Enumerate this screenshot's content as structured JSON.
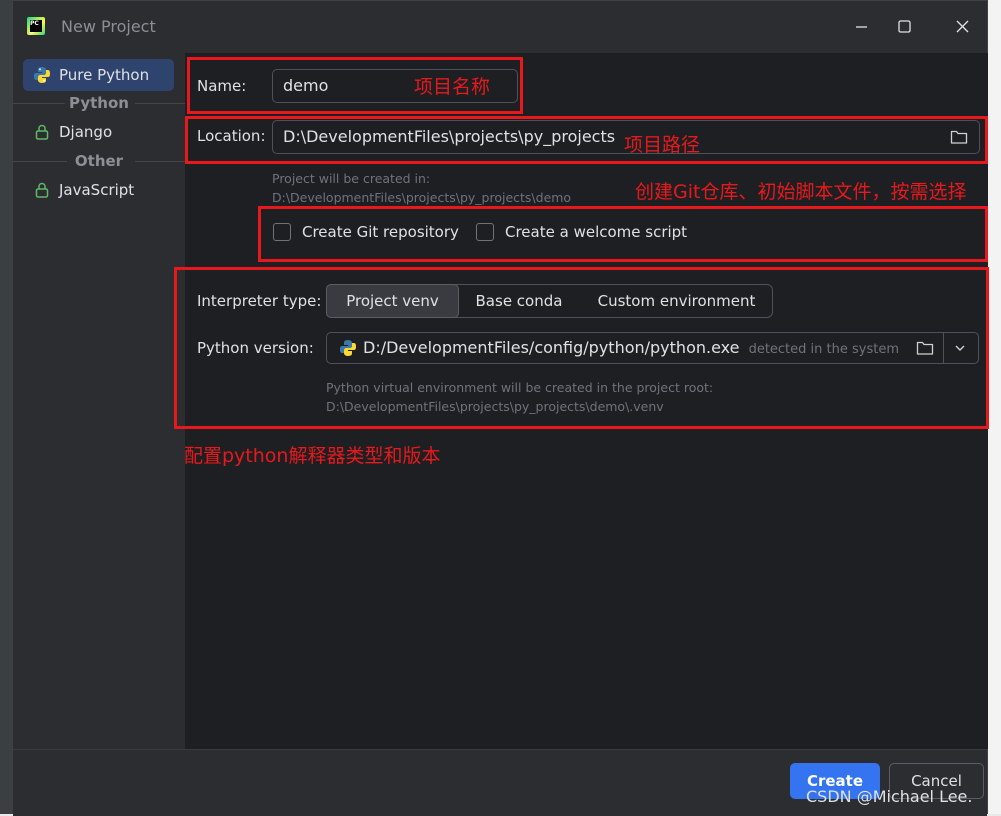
{
  "window": {
    "title": "New Project",
    "app_logo_text": "PC"
  },
  "sidebar": {
    "items": [
      {
        "label": "Pure Python",
        "selected": true,
        "icon": "python-icon"
      },
      {
        "label": "Django",
        "icon": "lock-icon"
      },
      {
        "label": "JavaScript",
        "icon": "lock-icon"
      }
    ],
    "groups": [
      "Python",
      "Other"
    ]
  },
  "form": {
    "name_label": "Name:",
    "name_value": "demo",
    "location_label": "Location:",
    "location_value": "D:\\DevelopmentFiles\\projects\\py_projects",
    "location_hint_1": "Project will be created in:",
    "location_hint_2": "D:\\DevelopmentFiles\\projects\\py_projects\\demo",
    "git_label": "Create Git repository",
    "welcome_label": "Create a welcome script",
    "interpreter_type_label": "Interpreter type:",
    "interpreter_options": [
      "Project venv",
      "Base conda",
      "Custom environment"
    ],
    "interpreter_selected": "Project venv",
    "python_version_label": "Python version:",
    "python_version_value": "D:/DevelopmentFiles/config/python/python.exe",
    "python_version_detected": "detected in the system",
    "venv_hint_1": "Python virtual environment will be created in the project root:",
    "venv_hint_2": "D:\\DevelopmentFiles\\projects\\py_projects\\demo\\.venv"
  },
  "annotations": {
    "name": "项目名称",
    "location": "项目路径",
    "options": "创建Git仓库、初始脚本文件，按需选择",
    "interpreter": "配置python解释器类型和版本"
  },
  "footer": {
    "create_label": "Create",
    "cancel_label": "Cancel"
  },
  "watermark": "CSDN @Michael Lee.",
  "colors": {
    "accent": "#3574f0",
    "annotation": "#e8191c",
    "background": "#1e1f22"
  }
}
